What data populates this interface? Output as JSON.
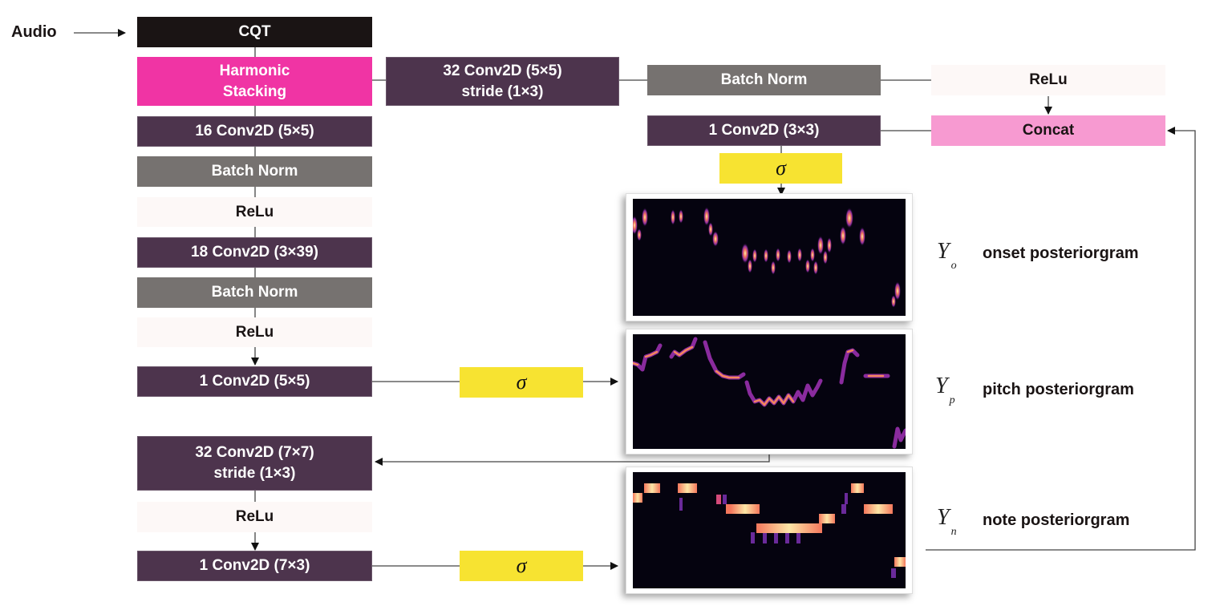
{
  "input_label": "Audio",
  "left_column": [
    {
      "id": "cqt",
      "label": "CQT",
      "style": "black"
    },
    {
      "id": "harmonic-stacking",
      "label": "Harmonic\nStacking",
      "style": "magenta"
    },
    {
      "id": "conv-16",
      "label": "16 Conv2D (5×5)",
      "style": "dark"
    },
    {
      "id": "batchnorm-1",
      "label": "Batch Norm",
      "style": "gray"
    },
    {
      "id": "relu-1",
      "label": "ReLu",
      "style": "relu"
    },
    {
      "id": "conv-18",
      "label": "18 Conv2D (3×39)",
      "style": "dark"
    },
    {
      "id": "batchnorm-2",
      "label": "Batch Norm",
      "style": "gray"
    },
    {
      "id": "relu-2",
      "label": "ReLu",
      "style": "relu"
    },
    {
      "id": "conv-1-5x5",
      "label": "1 Conv2D (5×5)",
      "style": "dark"
    },
    {
      "id": "conv-32-7x7",
      "label": "32 Conv2D (7×7)\nstride (1×3)",
      "style": "dark"
    },
    {
      "id": "relu-3",
      "label": "ReLu",
      "style": "relu"
    },
    {
      "id": "conv-1-7x3",
      "label": "1 Conv2D (7×3)",
      "style": "dark"
    }
  ],
  "top_branch": [
    {
      "id": "conv-32-5x5",
      "label": "32 Conv2D (5×5)\nstride (1×3)",
      "style": "dark"
    },
    {
      "id": "batchnorm-3",
      "label": "Batch Norm",
      "style": "gray"
    },
    {
      "id": "relu-4",
      "label": "ReLu",
      "style": "relu"
    },
    {
      "id": "concat",
      "label": "Concat",
      "style": "pink"
    },
    {
      "id": "conv-1-3x3",
      "label": "1 Conv2D (3×3)",
      "style": "dark"
    }
  ],
  "sigma_symbol": "σ",
  "outputs": [
    {
      "id": "onset",
      "symbol": "Y",
      "subscript": "o",
      "label": "onset posteriorgram"
    },
    {
      "id": "pitch",
      "symbol": "Y",
      "subscript": "p",
      "label": "pitch posteriorgram"
    },
    {
      "id": "note",
      "symbol": "Y",
      "subscript": "n",
      "label": "note posteriorgram"
    }
  ],
  "colors": {
    "conv": "#4d344d",
    "cqt": "#1a1414",
    "harmonic": "#f034a4",
    "batchnorm": "#767270",
    "relu": "#fdf8f7",
    "concat": "#f79ad1",
    "sigma": "#f7e331",
    "plot_bg": "#05030f"
  }
}
